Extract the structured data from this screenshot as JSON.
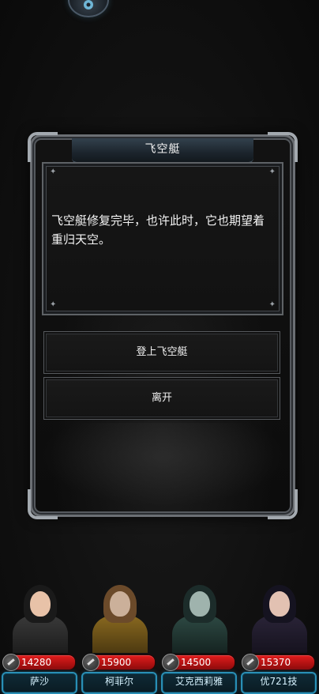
{
  "dialog": {
    "title": "飞空艇",
    "message": "飞空艇修复完毕，也许此时，它也期望着重归天空。",
    "options": [
      {
        "label": "登上飞空艇"
      },
      {
        "label": "离开"
      }
    ]
  },
  "party": [
    {
      "name": "萨沙",
      "hp": "14280"
    },
    {
      "name": "柯菲尔",
      "hp": "15900"
    },
    {
      "name": "艾克西莉雅",
      "hp": "14500"
    },
    {
      "name": "优721技",
      "hp": "15370"
    }
  ],
  "colors": {
    "hp_bar": "#d01818",
    "name_plate_border": "#2a8fb5",
    "dialog_border": "#6b6f74"
  }
}
